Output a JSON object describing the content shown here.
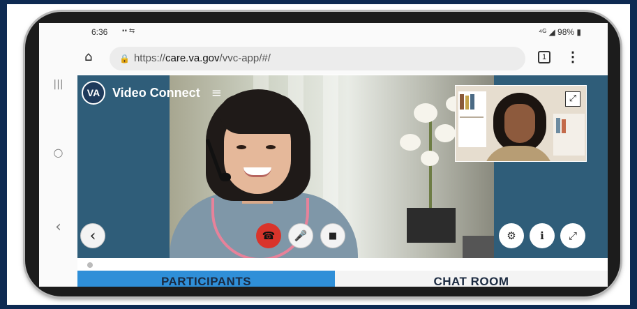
{
  "status_bar": {
    "time": "6:36",
    "left_icons": "▪▪ ⇆",
    "right": "⁴ᴳ ◢ 98% ▮"
  },
  "browser": {
    "home_icon": "⌂",
    "lock_icon": "🔒",
    "url_prefix": "https://",
    "url_domain": "care.va.gov",
    "url_path": "/vvc-app/#/",
    "tab_count": "1",
    "menu_icon": "⋮"
  },
  "nav": {
    "recent_icon": "|||",
    "home_icon": "○",
    "back_icon": "‹"
  },
  "app": {
    "logo_text": "VA",
    "title": "Video Connect",
    "menu_icon": "≡"
  },
  "pip": {
    "expand_icon": "⤢"
  },
  "controls": {
    "back": "‹",
    "hangup": "☎",
    "mic": "🎤",
    "camera": "■",
    "settings": "⚙",
    "info": "ℹ",
    "fullscreen": "⤢"
  },
  "tabs": [
    {
      "label": "PARTICIPANTS"
    },
    {
      "label": "CHAT ROOM"
    }
  ],
  "colors": {
    "background": "#0e2a52",
    "app_panel": "#2f5d79",
    "active_tab": "#2f8fd8",
    "hangup": "#d9342b"
  }
}
